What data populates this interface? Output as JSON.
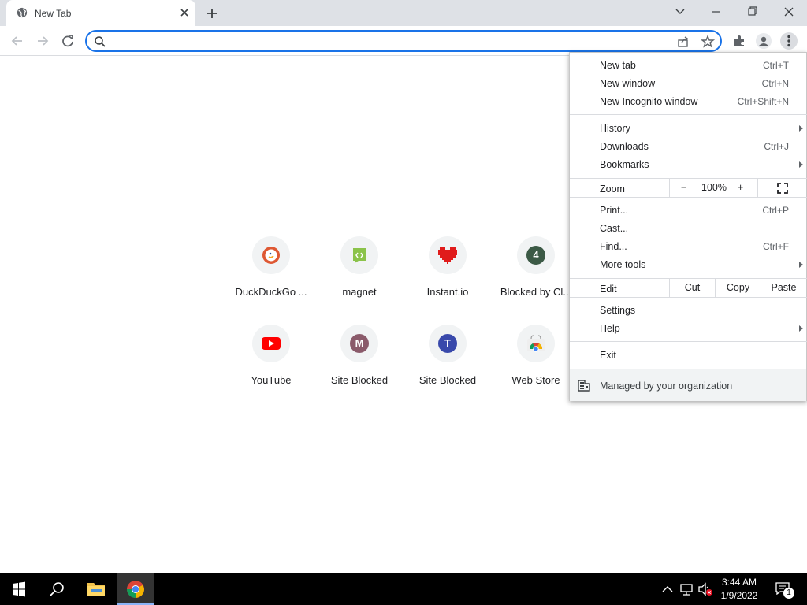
{
  "tab": {
    "title": "New Tab"
  },
  "omnibox": {
    "value": "",
    "placeholder": ""
  },
  "tiles": [
    {
      "label": "DuckDuckGo ...",
      "icon": "duckduckgo-icon"
    },
    {
      "label": "magnet",
      "icon": "magnet-icon"
    },
    {
      "label": "Instant.io",
      "icon": "heart-icon"
    },
    {
      "label": "Blocked by Cl...",
      "letter": "4",
      "color": "#3c5a46"
    },
    {
      "label": "YouTube",
      "icon": "youtube-icon"
    },
    {
      "label": "Site Blocked",
      "letter": "M",
      "color": "#8a5a6a"
    },
    {
      "label": "Site Blocked",
      "letter": "T",
      "color": "#3949ab"
    },
    {
      "label": "Web Store",
      "icon": "chrome-web-store-icon"
    }
  ],
  "menu": {
    "new_tab": {
      "label": "New tab",
      "shortcut": "Ctrl+T"
    },
    "new_window": {
      "label": "New window",
      "shortcut": "Ctrl+N"
    },
    "new_incognito": {
      "label": "New Incognito window",
      "shortcut": "Ctrl+Shift+N"
    },
    "history": {
      "label": "History"
    },
    "downloads": {
      "label": "Downloads",
      "shortcut": "Ctrl+J"
    },
    "bookmarks": {
      "label": "Bookmarks"
    },
    "zoom": {
      "label": "Zoom",
      "minus": "−",
      "value": "100%",
      "plus": "+"
    },
    "print": {
      "label": "Print...",
      "shortcut": "Ctrl+P"
    },
    "cast": {
      "label": "Cast..."
    },
    "find": {
      "label": "Find...",
      "shortcut": "Ctrl+F"
    },
    "more_tools": {
      "label": "More tools"
    },
    "edit": {
      "label": "Edit",
      "cut": "Cut",
      "copy": "Copy",
      "paste": "Paste"
    },
    "settings": {
      "label": "Settings"
    },
    "help": {
      "label": "Help"
    },
    "exit": {
      "label": "Exit"
    },
    "managed": {
      "label": "Managed by your organization"
    }
  },
  "taskbar": {
    "time": "3:44 AM",
    "date": "1/9/2022",
    "notification_count": "1"
  },
  "colors": {
    "accent": "#1a73e8",
    "tabbar": "#dee1e6",
    "taskbar": "#000000"
  }
}
